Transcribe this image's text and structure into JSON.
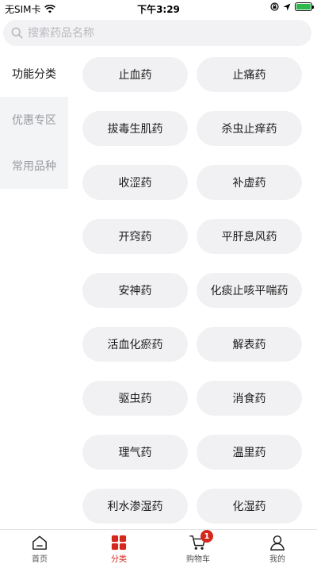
{
  "status": {
    "carrier": "无SIM卡",
    "time": "下午3:29"
  },
  "search": {
    "placeholder": "搜索药品名称"
  },
  "sidebar": {
    "items": [
      {
        "label": "功能分类",
        "active": true
      },
      {
        "label": "优惠专区",
        "active": false
      },
      {
        "label": "常用品种",
        "active": false
      }
    ]
  },
  "categories": [
    "止血药",
    "止痛药",
    "拔毒生肌药",
    "杀虫止痒药",
    "收涩药",
    "补虚药",
    "开窍药",
    "平肝息风药",
    "安神药",
    "化痰止咳平喘药",
    "活血化瘀药",
    "解表药",
    "驱虫药",
    "消食药",
    "理气药",
    "温里药",
    "利水渗湿药",
    "化湿药"
  ],
  "tabbar": {
    "items": [
      {
        "label": "首页",
        "icon": "home-icon",
        "active": false
      },
      {
        "label": "分类",
        "icon": "category-icon",
        "active": true
      },
      {
        "label": "购物车",
        "icon": "cart-icon",
        "active": false,
        "badge": "1"
      },
      {
        "label": "我的",
        "icon": "user-icon",
        "active": false
      }
    ]
  },
  "colors": {
    "accent": "#d4281c",
    "chip_bg": "#f1f1f3",
    "sidebar_bg": "#f3f4f6"
  }
}
